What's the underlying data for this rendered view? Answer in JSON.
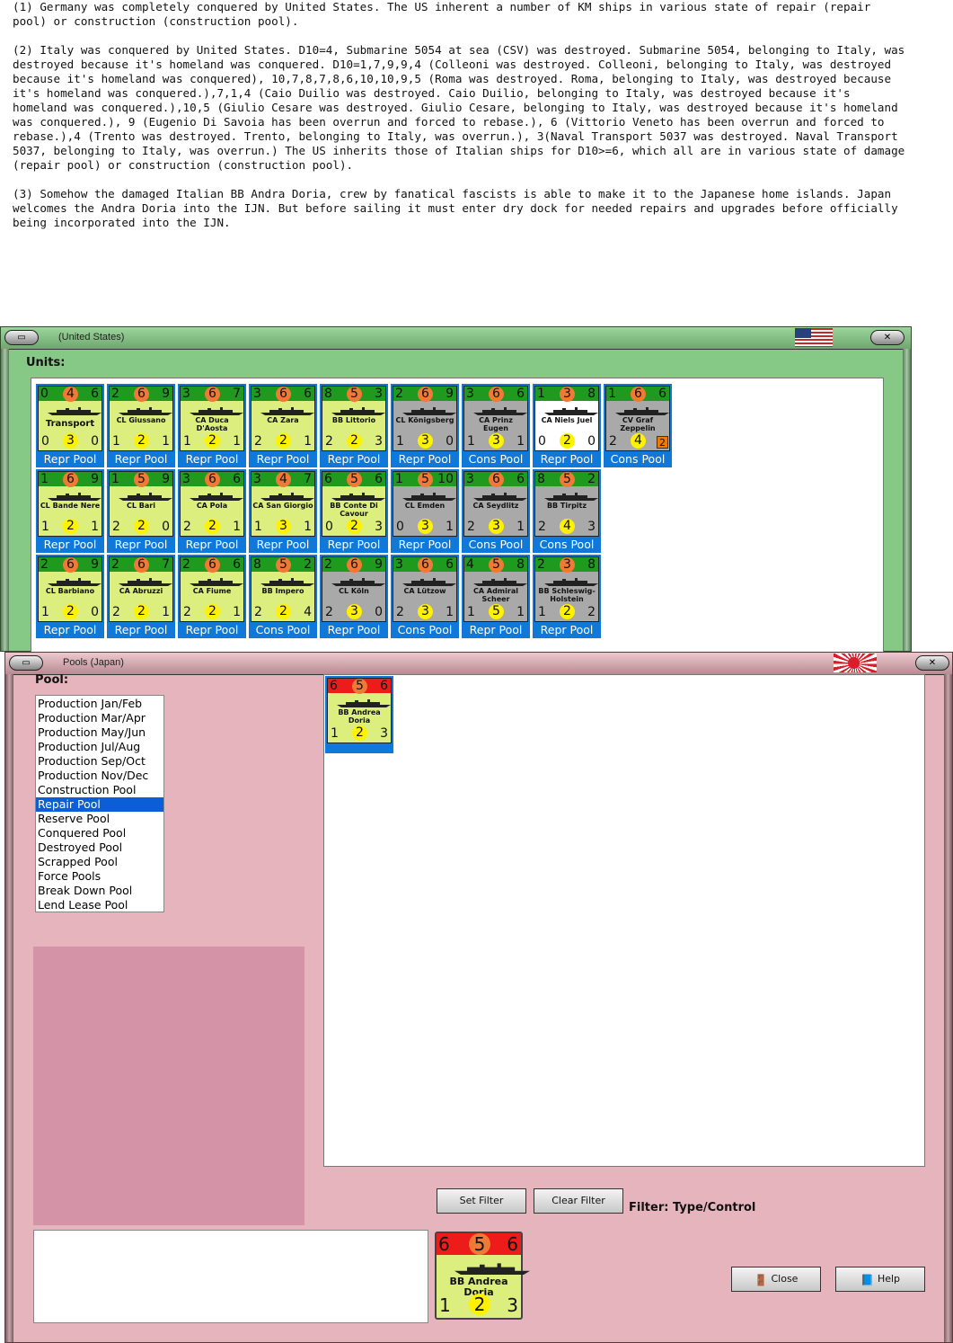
{
  "narrative": [
    "(1) Germany was completely conquered by United States.  The US inherent a number of KM ships in various state of repair (repair pool) or construction (construction pool).",
    "(2) Italy was conquered by United States.  D10=4, Submarine 5054 at sea (CSV) was destroyed.  Submarine 5054, belonging to Italy, was destroyed because it's homeland was conquered.   D10=1,7,9,9,4 (Colleoni was destroyed.  Colleoni, belonging to Italy, was destroyed because it's homeland was conquered), 10,7,8,7,8,6,10,10,9,5 (Roma was destroyed.  Roma, belonging to Italy, was destroyed because it's homeland was conquered.),7,1,4 (Caio Duilio was destroyed.  Caio Duilio, belonging to Italy, was destroyed because it's homeland was conquered.),10,5 (Giulio Cesare was destroyed.  Giulio Cesare, belonging to Italy, was destroyed because it's homeland was conquered.), 9 (Eugenio Di Savoia has been overrun and forced to rebase.), 6 (Vittorio Veneto has been overrun and forced to rebase.),4 (Trento was destroyed.  Trento, belonging to Italy, was overrun.), 3(Naval Transport 5037 was destroyed.  Naval Transport 5037, belonging to Italy, was overrun.)  The US inherits those of Italian ships for D10>=6, which all are in various state of damage (repair pool) or construction (construction pool).",
    "(3)  Somehow the damaged Italian BB Andra Doria, crew by fanatical fascists is able to make it to the Japanese home islands.  Japan welcomes the Andra Doria into the IJN.  But before sailing it must enter dry dock for needed repairs and upgrades before officially being incorporated into the IJN."
  ],
  "us_window": {
    "title": "(United States)",
    "units_label": "Units:",
    "minimize_icon": "minimize-icon",
    "close_icon": "close-icon"
  },
  "us_units": [
    {
      "name": "Transport",
      "tl": "0",
      "top": "4",
      "tr": "6",
      "bl": "0",
      "bottom": "3",
      "br": "0",
      "color": "green",
      "pool": "Repr Pool",
      "big": true
    },
    {
      "name": "CL Giussano",
      "tl": "2",
      "top": "6",
      "tr": "9",
      "bl": "1",
      "bottom": "2",
      "br": "1",
      "color": "green",
      "pool": "Repr Pool"
    },
    {
      "name": "CA Duca D'Aosta",
      "tl": "3",
      "top": "6",
      "tr": "7",
      "bl": "1",
      "bottom": "2",
      "br": "1",
      "color": "green",
      "pool": "Repr Pool"
    },
    {
      "name": "CA Zara",
      "tl": "3",
      "top": "6",
      "tr": "6",
      "bl": "2",
      "bottom": "2",
      "br": "1",
      "color": "green",
      "pool": "Repr Pool"
    },
    {
      "name": "BB Littorio",
      "tl": "8",
      "top": "5",
      "tr": "3",
      "bl": "2",
      "bottom": "2",
      "br": "3",
      "color": "green",
      "pool": "Repr Pool"
    },
    {
      "name": "CL Königsberg",
      "tl": "2",
      "top": "6",
      "tr": "9",
      "bl": "1",
      "bottom": "3",
      "br": "0",
      "color": "grey",
      "pool": "Repr Pool"
    },
    {
      "name": "CA Prinz Eugen",
      "tl": "3",
      "top": "6",
      "tr": "6",
      "bl": "1",
      "bottom": "3",
      "br": "1",
      "color": "grey",
      "pool": "Cons Pool"
    },
    {
      "name": "CA Niels Juel",
      "tl": "1",
      "top": "3",
      "tr": "8",
      "bl": "0",
      "bottom": "2",
      "br": "0",
      "color": "white",
      "pool": "Repr Pool"
    },
    {
      "name": "CV Graf Zeppelin",
      "tl": "1",
      "top": "6",
      "tr": "6",
      "bl": "2",
      "bottom": "4",
      "br": "",
      "badge": "2",
      "color": "grey",
      "pool": "Cons Pool"
    },
    {
      "name": "CL Bande Nere",
      "tl": "1",
      "top": "6",
      "tr": "9",
      "bl": "1",
      "bottom": "2",
      "br": "1",
      "color": "green",
      "pool": "Repr Pool"
    },
    {
      "name": "CL Bari",
      "tl": "1",
      "top": "5",
      "tr": "9",
      "bl": "2",
      "bottom": "2",
      "br": "0",
      "color": "green",
      "pool": "Repr Pool"
    },
    {
      "name": "CA Pola",
      "tl": "3",
      "top": "6",
      "tr": "6",
      "bl": "2",
      "bottom": "2",
      "br": "1",
      "color": "green",
      "pool": "Repr Pool"
    },
    {
      "name": "CA San Giorgio",
      "tl": "3",
      "top": "4",
      "tr": "7",
      "bl": "1",
      "bottom": "3",
      "br": "1",
      "color": "green",
      "pool": "Repr Pool"
    },
    {
      "name": "BB Conte Di Cavour",
      "tl": "6",
      "top": "5",
      "tr": "6",
      "bl": "0",
      "bottom": "2",
      "br": "3",
      "color": "green",
      "pool": "Repr Pool"
    },
    {
      "name": "CL Emden",
      "tl": "1",
      "top": "5",
      "tr": "10",
      "bl": "0",
      "bottom": "3",
      "br": "1",
      "color": "grey",
      "pool": "Repr Pool"
    },
    {
      "name": "CA Seydlitz",
      "tl": "3",
      "top": "6",
      "tr": "6",
      "bl": "2",
      "bottom": "3",
      "br": "1",
      "color": "grey",
      "pool": "Cons Pool"
    },
    {
      "name": "BB Tirpitz",
      "tl": "8",
      "top": "5",
      "tr": "2",
      "bl": "2",
      "bottom": "4",
      "br": "3",
      "color": "grey",
      "pool": "Cons Pool"
    },
    {
      "name": "CL Barbiano",
      "tl": "2",
      "top": "6",
      "tr": "9",
      "bl": "1",
      "bottom": "2",
      "br": "0",
      "color": "green",
      "pool": "Repr Pool"
    },
    {
      "name": "CA Abruzzi",
      "tl": "2",
      "top": "6",
      "tr": "7",
      "bl": "2",
      "bottom": "2",
      "br": "1",
      "color": "green",
      "pool": "Repr Pool"
    },
    {
      "name": "CA Fiume",
      "tl": "2",
      "top": "6",
      "tr": "6",
      "bl": "2",
      "bottom": "2",
      "br": "1",
      "color": "green",
      "pool": "Repr Pool"
    },
    {
      "name": "BB Impero",
      "tl": "8",
      "top": "5",
      "tr": "2",
      "bl": "2",
      "bottom": "2",
      "br": "4",
      "color": "green",
      "pool": "Cons Pool"
    },
    {
      "name": "CL Köln",
      "tl": "2",
      "top": "6",
      "tr": "9",
      "bl": "2",
      "bottom": "3",
      "br": "0",
      "color": "grey",
      "pool": "Repr Pool"
    },
    {
      "name": "CA Lützow",
      "tl": "3",
      "top": "6",
      "tr": "6",
      "bl": "2",
      "bottom": "3",
      "br": "1",
      "color": "grey",
      "pool": "Cons Pool"
    },
    {
      "name": "CA Admiral Scheer",
      "tl": "4",
      "top": "5",
      "tr": "8",
      "bl": "1",
      "bottom": "5",
      "br": "1",
      "color": "grey",
      "pool": "Repr Pool"
    },
    {
      "name": "BB Schleswig-Holstein",
      "tl": "2",
      "top": "3",
      "tr": "8",
      "bl": "1",
      "bottom": "2",
      "br": "2",
      "color": "grey",
      "pool": "Repr Pool"
    }
  ],
  "jp_window": {
    "title": "Pools (Japan)",
    "pool_label": "Pool:",
    "pools": [
      "Production Jan/Feb",
      "Production Mar/Apr",
      "Production May/Jun",
      "Production Jul/Aug",
      "Production Sep/Oct",
      "Production Nov/Dec",
      "Construction Pool",
      "Repair Pool",
      "Reserve Pool",
      "Conquered Pool",
      "Destroyed Pool",
      "Scrapped Pool",
      "Force Pools",
      "Break Down Pool",
      "Lend Lease Pool"
    ],
    "selected_pool": "Repair Pool",
    "set_filter": "Set Filter",
    "clear_filter": "Clear Filter",
    "filter_text": "Filter:  Type/Control",
    "close_label": "Close",
    "help_label": "Help"
  },
  "jp_unit": {
    "name": "BB Andrea Doria",
    "tl": "6",
    "top": "5",
    "tr": "6",
    "bl": "1",
    "bottom": "2",
    "br": "3"
  },
  "colors": {
    "us_frame": "#86c886",
    "jp_frame": "#e6b4bd",
    "counter_green": "#dcee7e",
    "counter_grey": "#a9a9a9",
    "bar_green": "#1f9a1f",
    "bar_red": "#ee1b1b",
    "pool_label_bg": "#0f78d8",
    "selection": "#0a5fd6"
  }
}
